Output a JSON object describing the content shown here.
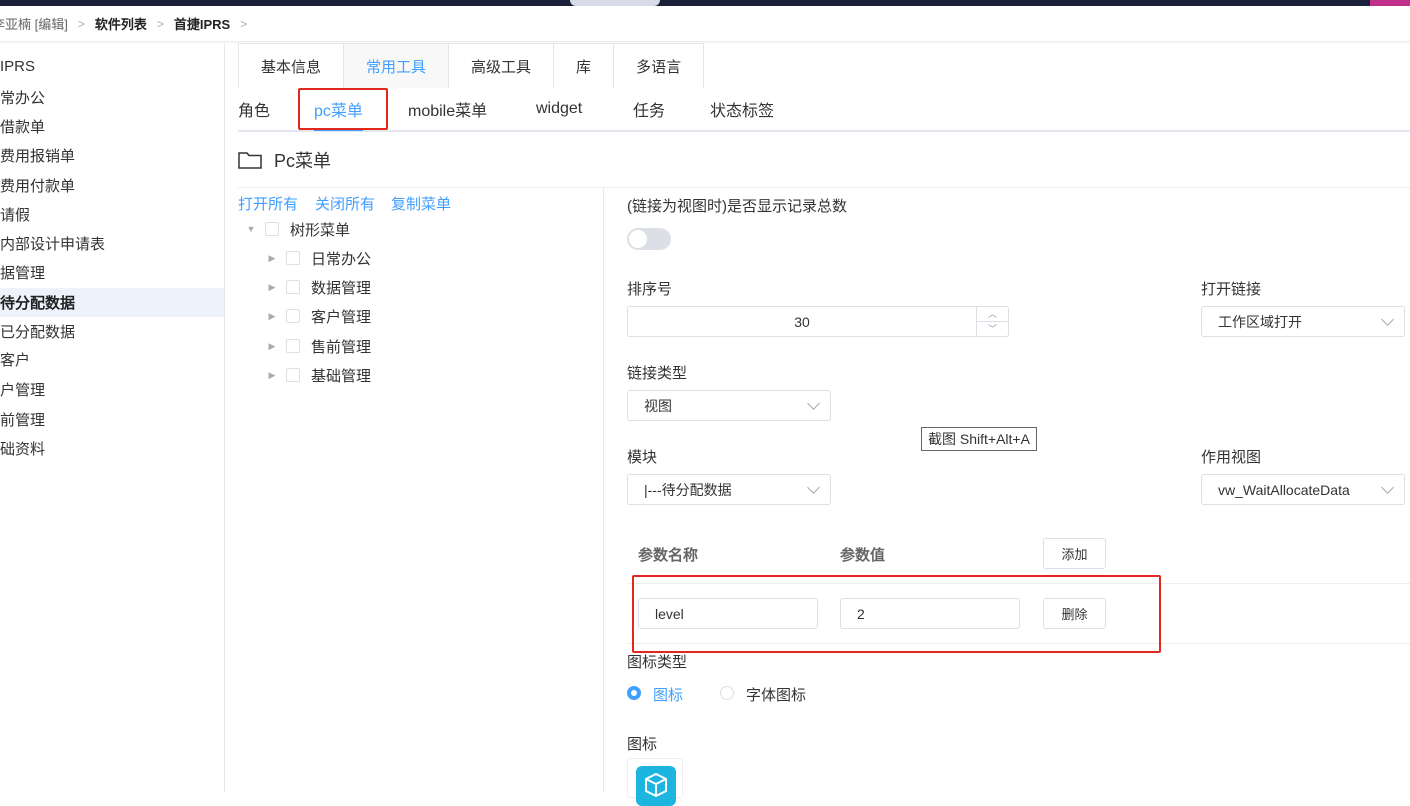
{
  "breadcrumb": {
    "user": "李亚楠 [编辑]",
    "software_list": "软件列表",
    "current": "首捷IPRS",
    "sep": ">"
  },
  "sidebar": {
    "items": [
      {
        "label": "IPRS"
      },
      {
        "label": "常办公"
      },
      {
        "label": "借款单"
      },
      {
        "label": "费用报销单"
      },
      {
        "label": "费用付款单"
      },
      {
        "label": "请假"
      },
      {
        "label": "内部设计申请表"
      },
      {
        "label": "据管理"
      },
      {
        "label": "待分配数据"
      },
      {
        "label": "已分配数据"
      },
      {
        "label": "客户"
      },
      {
        "label": "户管理"
      },
      {
        "label": "前管理"
      },
      {
        "label": "础资料"
      }
    ]
  },
  "tabs_primary": [
    "基本信息",
    "常用工具",
    "高级工具",
    "库",
    "多语言"
  ],
  "tabs_secondary": [
    "角色",
    "pc菜单",
    "mobile菜单",
    "widget",
    "任务",
    "状态标签"
  ],
  "section": {
    "title": "Pc菜单"
  },
  "tree": {
    "actions": [
      "打开所有",
      "关闭所有",
      "复制菜单"
    ],
    "root": "树形菜单",
    "children": [
      "日常办公",
      "数据管理",
      "客户管理",
      "售前管理",
      "基础管理"
    ]
  },
  "form": {
    "show_total_label": "(链接为视图时)是否显示记录总数",
    "sort_label": "排序号",
    "sort_value": "30",
    "open_link_label": "打开链接",
    "open_link_value": "工作区域打开",
    "link_type_label": "链接类型",
    "link_type_value": "视图",
    "module_label": "模块",
    "module_value": "|---待分配数据",
    "view_label": "作用视图",
    "view_value": "vw_WaitAllocateData",
    "param_name_header": "参数名称",
    "param_value_header": "参数值",
    "add_button": "添加",
    "param_name": "level",
    "param_value": "2",
    "delete_button": "删除",
    "icon_type_label": "图标类型",
    "icon_type_option1": "图标",
    "icon_type_option2": "字体图标",
    "icon_label": "图标"
  },
  "tooltip": "截图 Shift+Alt+A",
  "colors": {
    "accent": "#409eff",
    "highlight_box": "#e0281f"
  }
}
